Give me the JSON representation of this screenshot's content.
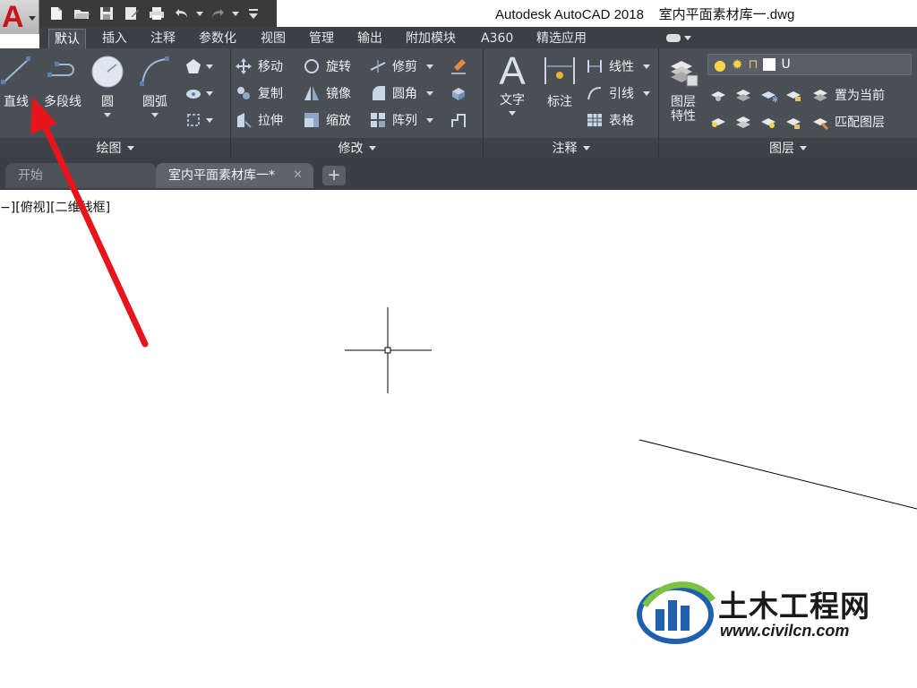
{
  "window": {
    "title": "Autodesk AutoCAD 2018    室内平面素材库一.dwg"
  },
  "app_button": {
    "icon": "autocad-logo-icon"
  },
  "quick_access": [
    {
      "name": "new-icon"
    },
    {
      "name": "open-icon"
    },
    {
      "name": "save-icon"
    },
    {
      "name": "save-as-icon"
    },
    {
      "name": "print-icon"
    },
    {
      "name": "undo-icon"
    },
    {
      "name": "redo-icon"
    },
    {
      "name": "customize-icon"
    }
  ],
  "ribbon_tabs": [
    {
      "label": "默认",
      "active": true
    },
    {
      "label": "插入"
    },
    {
      "label": "注释"
    },
    {
      "label": "参数化"
    },
    {
      "label": "视图"
    },
    {
      "label": "管理"
    },
    {
      "label": "输出"
    },
    {
      "label": "附加模块"
    },
    {
      "label": "A360"
    },
    {
      "label": "精选应用"
    }
  ],
  "panels": {
    "draw": {
      "title": "绘图",
      "line": "直线",
      "polyline": "多段线",
      "circle": "圆",
      "arc": "圆弧"
    },
    "modify": {
      "title": "修改",
      "move": "移动",
      "rotate": "旋转",
      "trim": "修剪",
      "copy": "复制",
      "mirror": "镜像",
      "fillet": "圆角",
      "stretch": "拉伸",
      "scale": "缩放",
      "array": "阵列"
    },
    "annotation": {
      "title": "注释",
      "text": "文字",
      "dimension": "标注",
      "linear": "线性",
      "leader": "引线",
      "table": "表格"
    },
    "layers": {
      "title": "图层",
      "layer_props": "图层",
      "layer_props2": "特性",
      "layer_name": "U",
      "set_current": "置为当前",
      "match_layer": "匹配图层"
    }
  },
  "doc_tabs": {
    "start": "开始",
    "current": "室内平面素材库一*",
    "close": "✕",
    "add": "+"
  },
  "viewport": {
    "label": "−][俯视][二维线框]"
  },
  "watermark": {
    "title": "土木工程网",
    "url": "www.civilcn.com"
  },
  "colors": {
    "ribbon_bg": "#4a4e55",
    "tab_bg": "#3b3f46",
    "accent_red": "#e8141c",
    "watermark_blue": "#1f5fae",
    "watermark_green": "#7cc242"
  }
}
